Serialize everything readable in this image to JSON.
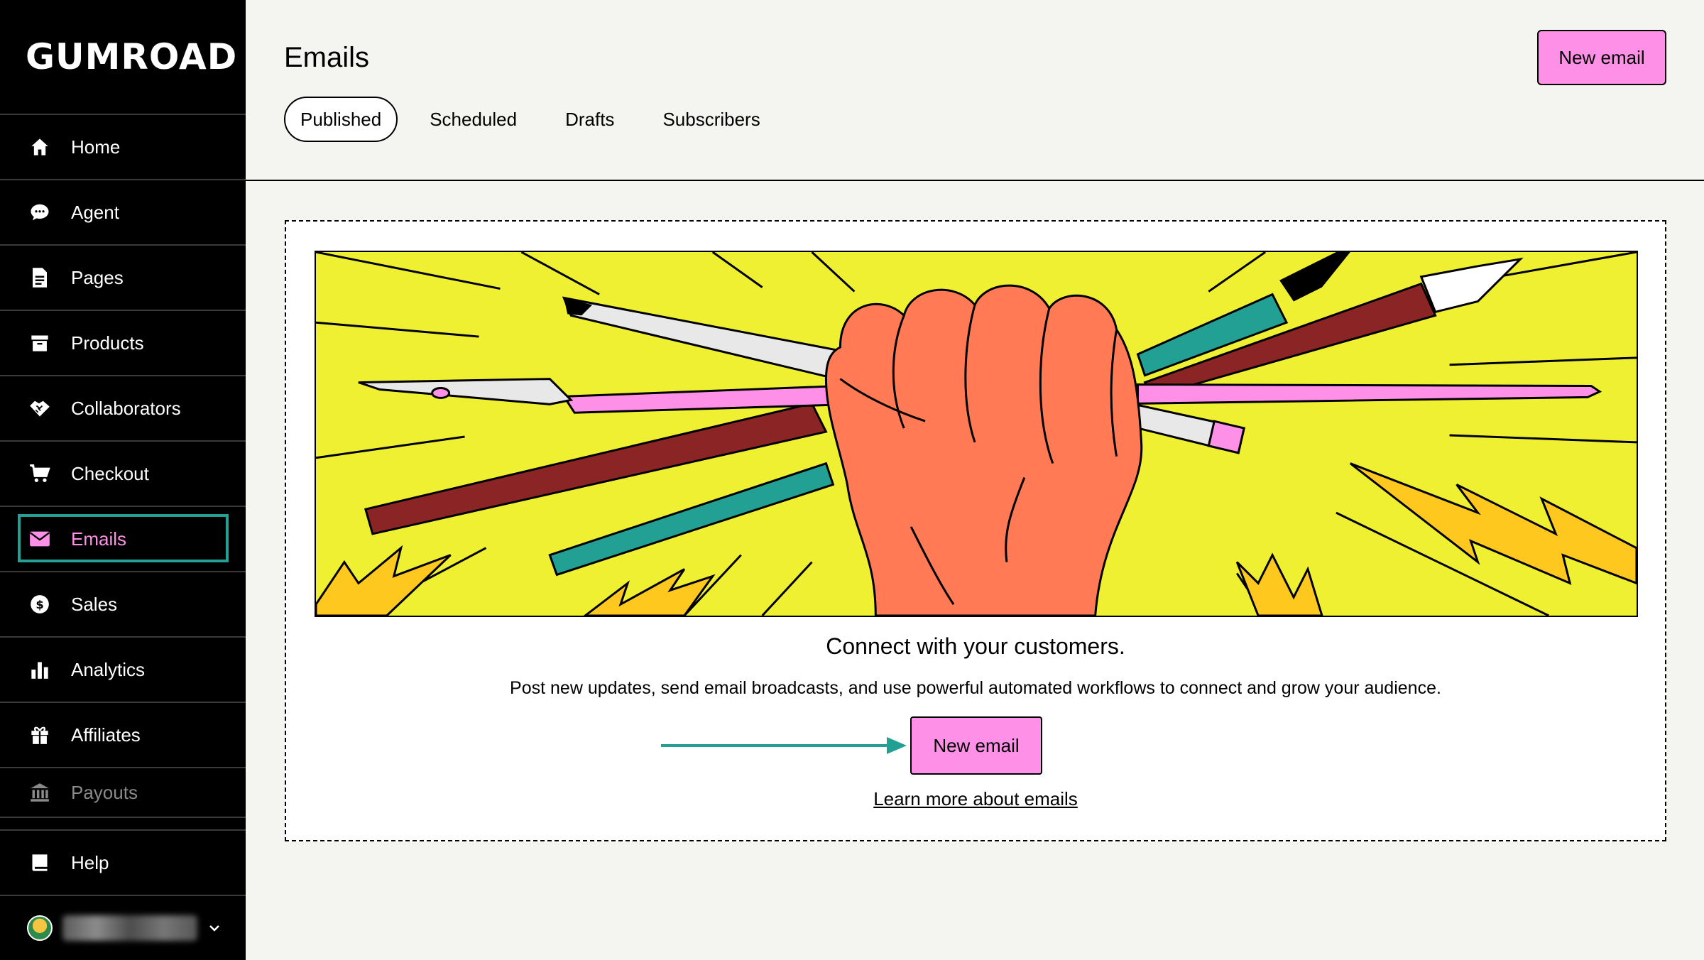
{
  "app": {
    "logo": "GUMROAD"
  },
  "sidebar": {
    "items": [
      {
        "label": "Home",
        "icon": "home-icon"
      },
      {
        "label": "Agent",
        "icon": "chat-bubble-icon"
      },
      {
        "label": "Pages",
        "icon": "document-icon"
      },
      {
        "label": "Products",
        "icon": "archive-box-icon"
      },
      {
        "label": "Collaborators",
        "icon": "handshake-icon"
      },
      {
        "label": "Checkout",
        "icon": "cart-icon"
      },
      {
        "label": "Emails",
        "icon": "envelope-icon",
        "active": true
      },
      {
        "label": "Sales",
        "icon": "dollar-circle-icon"
      },
      {
        "label": "Analytics",
        "icon": "bar-chart-icon"
      },
      {
        "label": "Affiliates",
        "icon": "gift-icon"
      },
      {
        "label": "Payouts",
        "icon": "bank-icon"
      }
    ],
    "help": {
      "label": "Help",
      "icon": "book-icon"
    },
    "account": {
      "icon": "chevron-down-icon"
    }
  },
  "header": {
    "title": "Emails",
    "new_email_label": "New email",
    "tabs": [
      {
        "label": "Published",
        "active": true
      },
      {
        "label": "Scheduled"
      },
      {
        "label": "Drafts"
      },
      {
        "label": "Subscribers"
      }
    ]
  },
  "empty_state": {
    "heading": "Connect with your customers.",
    "description": "Post new updates, send email broadcasts, and use powerful automated workflows to connect and grow your audience.",
    "button_label": "New email",
    "learn_more": "Learn more about emails"
  },
  "colors": {
    "accent_pink": "#ff90e8",
    "active_outline": "#23a094",
    "hero_yellow": "#f0f033",
    "fist": "#ff7a55"
  }
}
